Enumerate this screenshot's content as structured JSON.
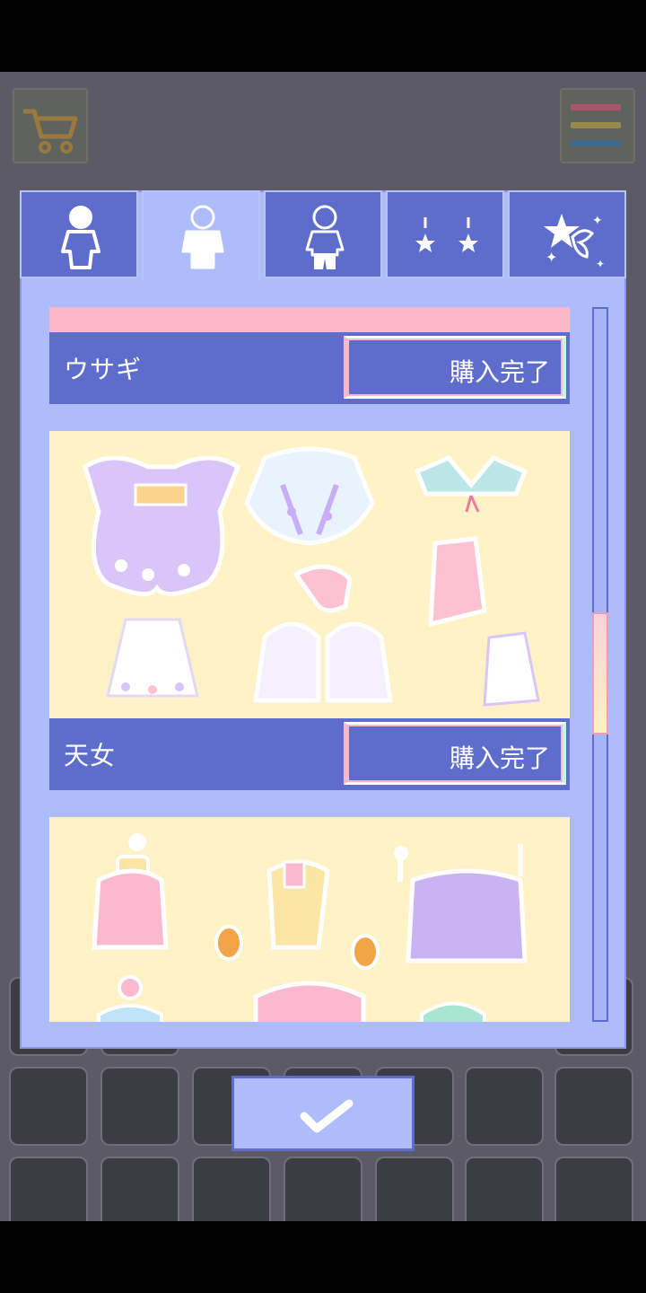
{
  "tabs": [
    {
      "icon": "body-figure-icon",
      "active": false
    },
    {
      "icon": "shirt-figure-icon",
      "active": true
    },
    {
      "icon": "bottoms-figure-icon",
      "active": false
    },
    {
      "icon": "earrings-icon",
      "active": false
    },
    {
      "icon": "sparkle-star-bow-icon",
      "active": false
    }
  ],
  "cards": [
    {
      "name": "ウサギ",
      "button_label": "購入完了"
    },
    {
      "name": "天女",
      "button_label": "購入完了"
    },
    {
      "name": "",
      "button_label": ""
    }
  ],
  "background": {
    "cart_icon": "shopping-cart-icon",
    "menu_icon": "menu-stripes-icon"
  },
  "confirm_icon": "checkmark-icon",
  "colors": {
    "tab_blue": "#5e6dcb",
    "panel_lavender": "#aebcfb",
    "art_cream": "#fff2c6",
    "pink_strip": "#fdb7c9"
  }
}
